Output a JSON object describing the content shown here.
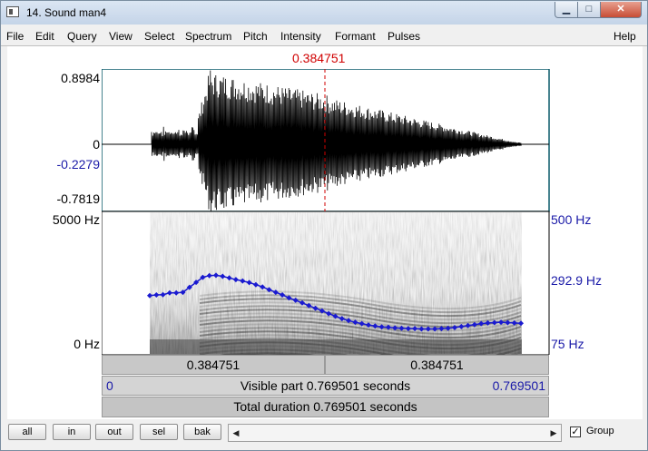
{
  "window": {
    "title": "14. Sound man4",
    "min_glyph": "▁",
    "max_glyph": "□",
    "close_glyph": "✕"
  },
  "menu": [
    "File",
    "Edit",
    "Query",
    "View",
    "Select",
    "Spectrum",
    "Pitch",
    "Intensity",
    "Formant",
    "Pulses"
  ],
  "menu_help": "Help",
  "cursor": {
    "time_label": "0.384751"
  },
  "waveform": {
    "max": "0.8984",
    "zero": "0",
    "cursor_value": "-0.2279",
    "min": "-0.7819"
  },
  "spectrogram": {
    "freq_top": "5000 Hz",
    "freq_bottom": "0 Hz"
  },
  "pitch_axis": {
    "top": "500 Hz",
    "mid": "292.9 Hz",
    "bottom": "75 Hz"
  },
  "pitch_contour_hz": [
    250,
    252,
    253,
    258,
    258,
    260,
    275,
    290,
    305,
    310,
    311,
    308,
    303,
    298,
    294,
    289,
    283,
    276,
    268,
    260,
    252,
    243,
    236,
    228,
    220,
    212,
    204,
    196,
    188,
    181,
    175,
    170,
    166,
    162,
    159,
    156,
    155,
    153,
    152,
    151,
    151,
    150,
    150,
    150,
    151,
    152,
    154,
    157,
    160,
    163,
    166,
    168,
    169,
    170,
    169,
    168,
    167
  ],
  "time_bars": {
    "left_segment": "0.384751",
    "right_segment": "0.384751",
    "visible_start": "0",
    "visible_label": "Visible part 0.769501 seconds",
    "visible_end": "0.769501",
    "total_label": "Total duration 0.769501 seconds"
  },
  "buttons": [
    "all",
    "in",
    "out",
    "sel",
    "bak"
  ],
  "group": {
    "label": "Group",
    "checked": true,
    "check_glyph": "✓"
  },
  "scroll_arrows": {
    "left": "◀",
    "right": "▶"
  },
  "colors": {
    "cursor": "#d00000",
    "pitch": "#1a1ad0",
    "axis_blue": "#1a1aa8"
  }
}
